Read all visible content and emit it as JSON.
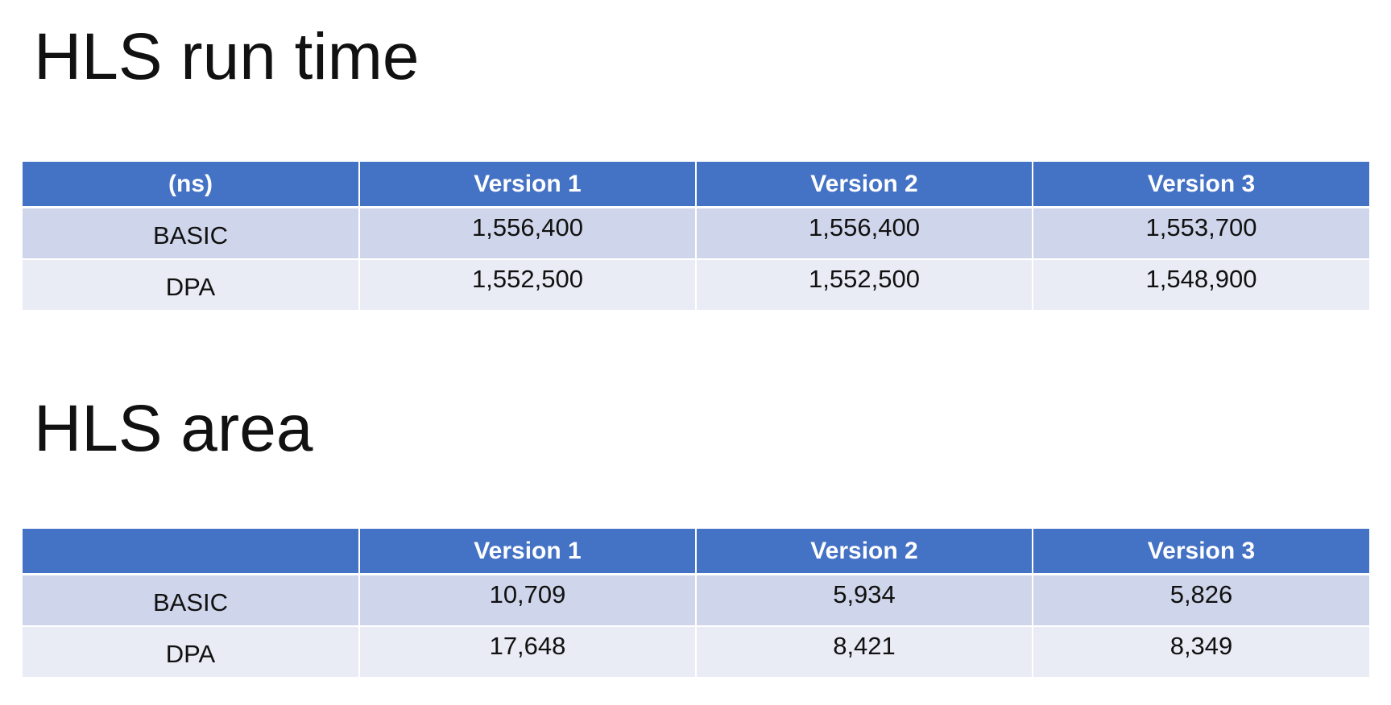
{
  "runtime": {
    "title": "HLS run time",
    "table": {
      "headers": [
        "(ns)",
        "Version 1",
        "Version 2",
        "Version 3"
      ],
      "rows": [
        {
          "label": "BASIC",
          "values": [
            "1,556,400",
            "1,556,400",
            "1,553,700"
          ]
        },
        {
          "label": "DPA",
          "values": [
            "1,552,500",
            "1,552,500",
            "1,548,900"
          ]
        }
      ]
    }
  },
  "area": {
    "title": "HLS area",
    "table": {
      "headers": [
        "",
        "Version 1",
        "Version 2",
        "Version 3"
      ],
      "rows": [
        {
          "label": "BASIC",
          "values": [
            "10,709",
            "5,934",
            "5,826"
          ]
        },
        {
          "label": "DPA",
          "values": [
            "17,648",
            "8,421",
            "8,349"
          ]
        }
      ]
    }
  },
  "colors": {
    "header_background": "#4472c4",
    "header_text": "#ffffff",
    "row_odd_background": "#cfd5ea",
    "row_even_background": "#e9ebf5"
  }
}
